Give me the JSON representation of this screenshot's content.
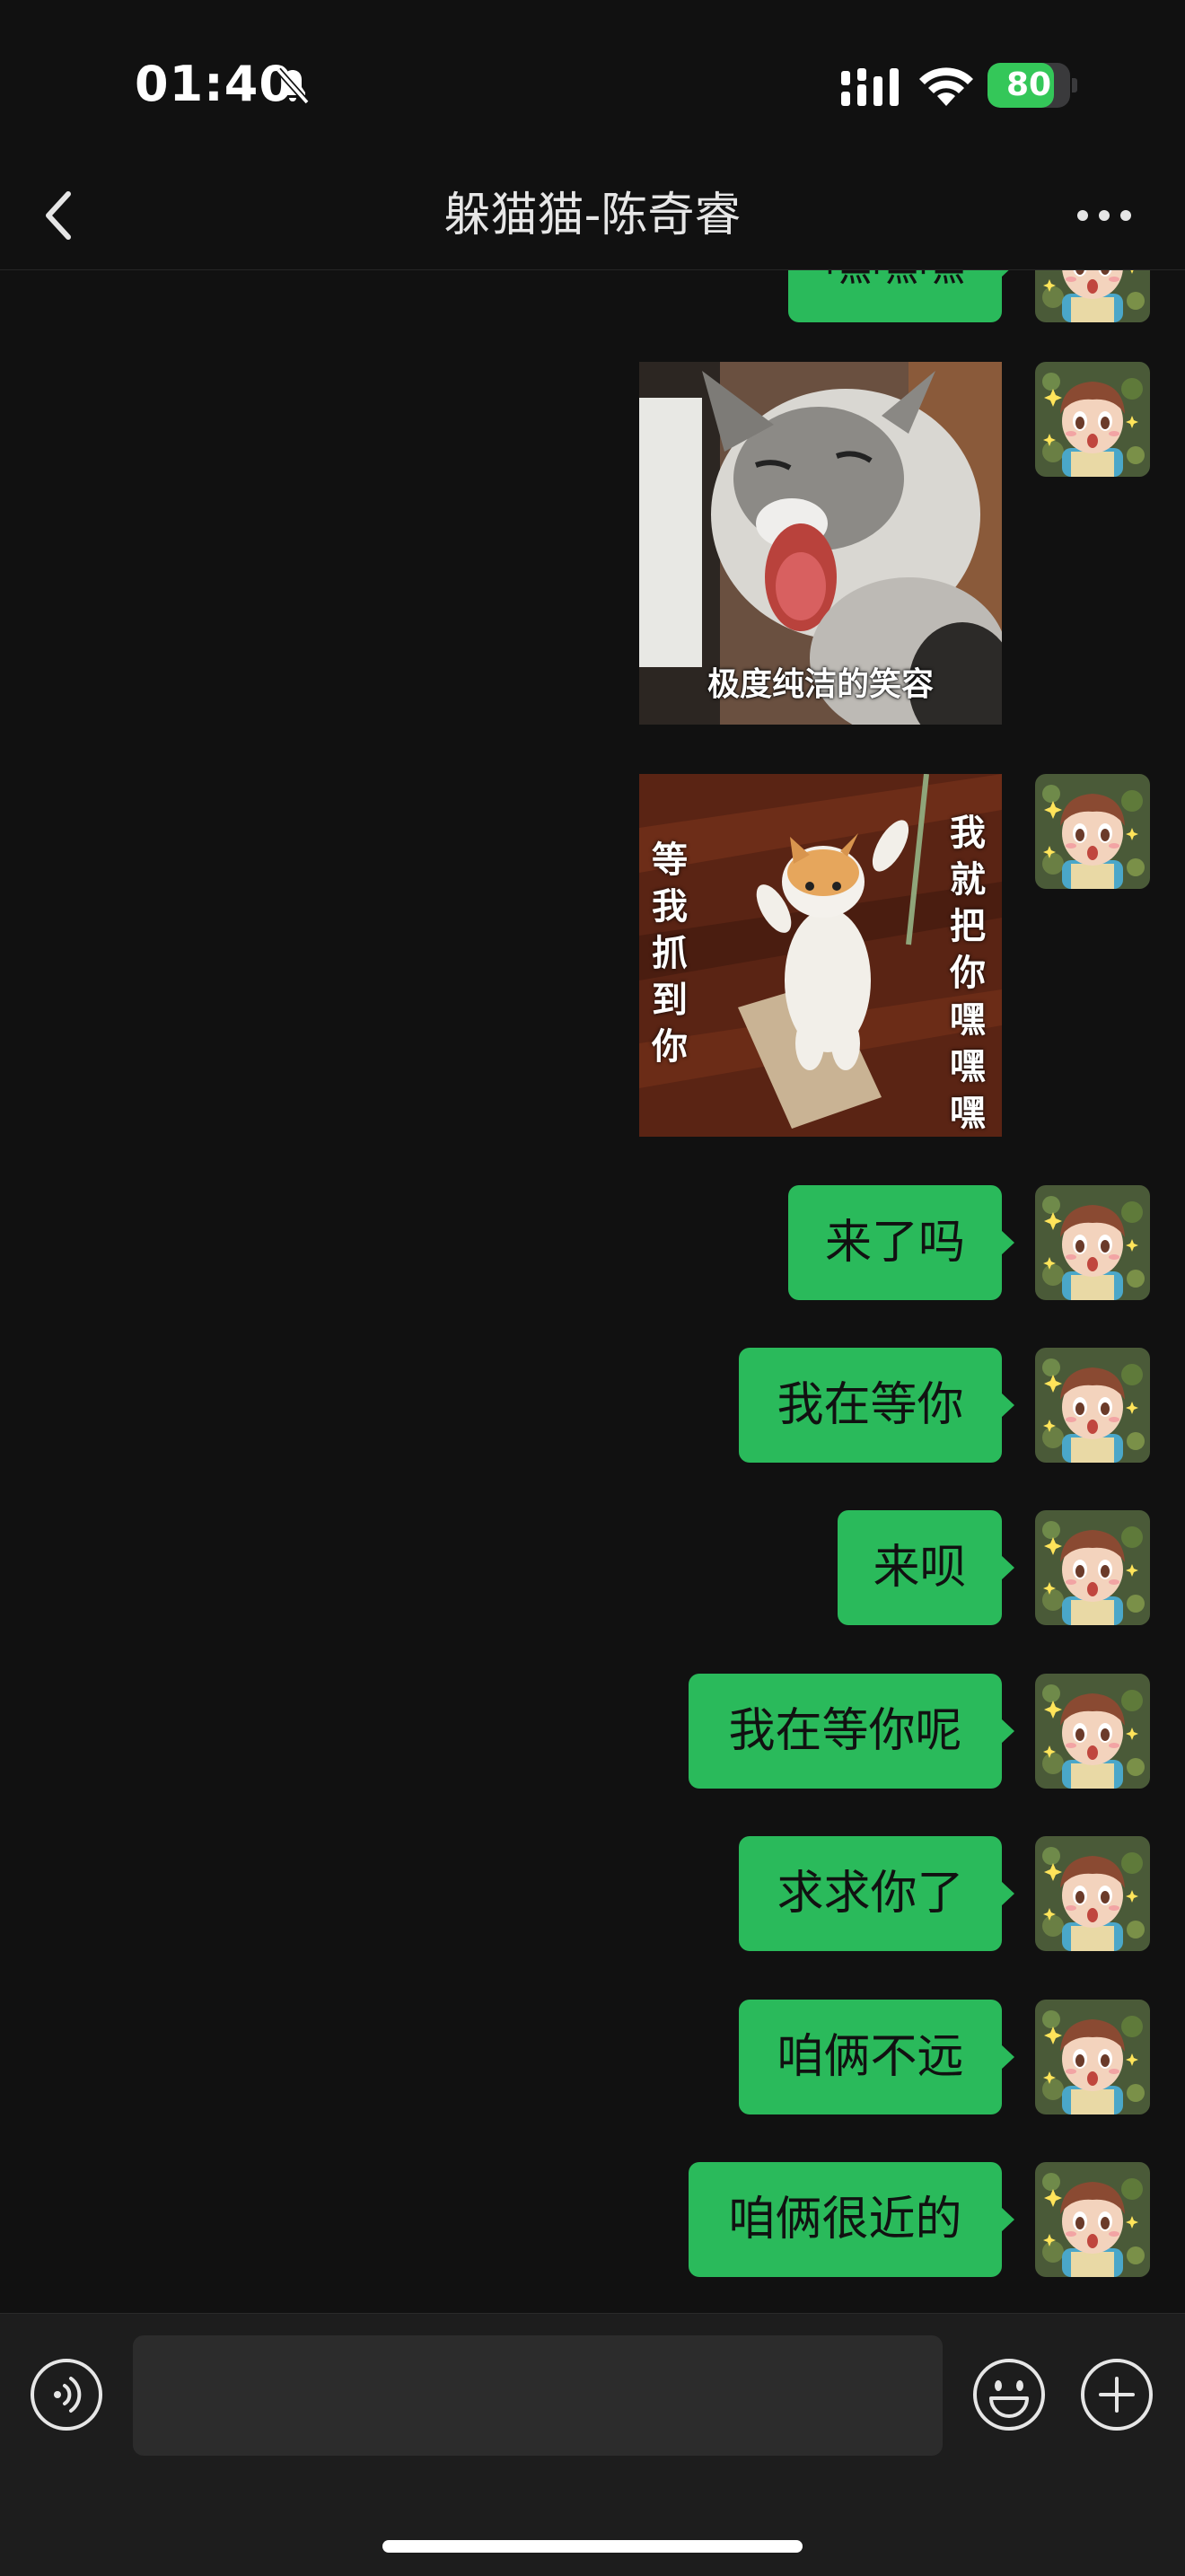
{
  "status_bar": {
    "time": "01:40",
    "battery_level": "80",
    "battery_fraction": 0.8,
    "icons": [
      "silent-bell-icon",
      "cellular-signal-icon",
      "wifi-icon",
      "battery-charging-icon"
    ]
  },
  "nav": {
    "title": "躲猫猫-陈奇睿",
    "back_icon": "chevron-left-icon",
    "more_icon": "more-dots-icon"
  },
  "chat": {
    "partial_top_message": "嘿嘿嘿",
    "stickers": [
      {
        "name": "laughing-cat-sticker",
        "caption": "极度纯洁的笑容"
      },
      {
        "name": "standing-cat-sticker",
        "caption_left": "等我抓到你",
        "caption_right": "我就把你嘿嘿嘿"
      }
    ],
    "messages": [
      {
        "text": "来了吗"
      },
      {
        "text": "我在等你"
      },
      {
        "text": "来呗"
      },
      {
        "text": "我在等你呢"
      },
      {
        "text": "求求你了"
      },
      {
        "text": "咱俩不远"
      },
      {
        "text": "咱俩很近的"
      }
    ]
  },
  "input_bar": {
    "placeholder": "",
    "value": "",
    "icons": [
      "voice-icon",
      "emoji-icon",
      "plus-icon"
    ]
  },
  "colors": {
    "background": "#111111",
    "bubble": "#2aba5b",
    "battery": "#34c759"
  }
}
